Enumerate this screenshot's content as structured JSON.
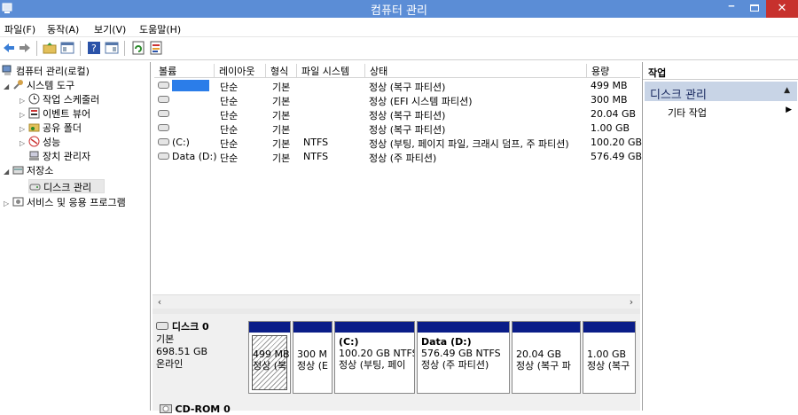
{
  "window": {
    "title": "컴퓨터 관리",
    "close": "✕",
    "minimize": "‒"
  },
  "menu": [
    "파일(F)",
    "동작(A)",
    "보기(V)",
    "도움말(H)"
  ],
  "tree": {
    "root": "컴퓨터 관리(로컬)",
    "system_tools": "시스템 도구",
    "task_scheduler": "작업 스케줄러",
    "event_viewer": "이벤트 뷰어",
    "shared_folders": "공유 폴더",
    "performance": "성능",
    "device_manager": "장치 관리자",
    "storage": "저장소",
    "disk_management": "디스크 관리",
    "services": "서비스 및 응용 프로그램"
  },
  "columns": [
    "볼륨",
    "레이아웃",
    "형식",
    "파일 시스템",
    "상태",
    "용량"
  ],
  "volumes": [
    {
      "name": "",
      "layout": "단순",
      "type": "기본",
      "fs": "",
      "status": "정상 (복구 파티션)",
      "size": "499 MB"
    },
    {
      "name": "",
      "layout": "단순",
      "type": "기본",
      "fs": "",
      "status": "정상 (EFI 시스템 파티션)",
      "size": "300 MB"
    },
    {
      "name": "",
      "layout": "단순",
      "type": "기본",
      "fs": "",
      "status": "정상 (복구 파티션)",
      "size": "20.04 GB"
    },
    {
      "name": "",
      "layout": "단순",
      "type": "기본",
      "fs": "",
      "status": "정상 (복구 파티션)",
      "size": "1.00 GB"
    },
    {
      "name": "(C:)",
      "layout": "단순",
      "type": "기본",
      "fs": "NTFS",
      "status": "정상 (부팅, 페이지 파일, 크래시 덤프, 주 파티션)",
      "size": "100.20 GB"
    },
    {
      "name": "Data (D:)",
      "layout": "단순",
      "type": "기본",
      "fs": "NTFS",
      "status": "정상 (주 파티션)",
      "size": "576.49 GB"
    }
  ],
  "disk0": {
    "name": "디스크 0",
    "type": "기본",
    "size": "698.51 GB",
    "state": "온라인",
    "partitions": [
      {
        "title": "",
        "line1": "499 MB",
        "line2": "정상 (복"
      },
      {
        "title": "",
        "line1": "300 M",
        "line2": "정상 (E"
      },
      {
        "title": "(C:)",
        "line1": "100.20 GB NTFS",
        "line2": "정상 (부팅, 페이"
      },
      {
        "title": "Data  (D:)",
        "line1": "576.49 GB NTFS",
        "line2": "정상 (주 파티션)"
      },
      {
        "title": "",
        "line1": "20.04 GB",
        "line2": "정상 (복구 파"
      },
      {
        "title": "",
        "line1": "1.00 GB",
        "line2": "정상 (복구"
      }
    ]
  },
  "cdrom": "CD-ROM 0",
  "actions": {
    "header": "작업",
    "section": "디스크 관리",
    "more": "기타 작업"
  },
  "colors": {
    "title_bar": "#5b8dd6",
    "partition_band": "#0a1d88",
    "selection_highlight": "#2b7de9",
    "close_button": "#c7312d"
  }
}
